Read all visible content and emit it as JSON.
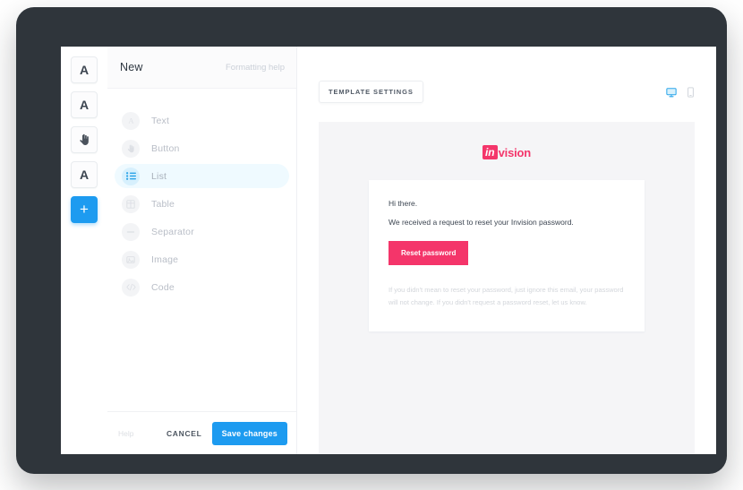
{
  "toolbar": {
    "buttons": [
      {
        "name": "text-style-heading",
        "glyph": "A",
        "accent": false
      },
      {
        "name": "text-style-body",
        "glyph": "A",
        "accent": false
      },
      {
        "name": "pointer-tool",
        "glyph": "hand",
        "accent": false
      },
      {
        "name": "text-style-small",
        "glyph": "A",
        "accent": false
      },
      {
        "name": "add-block",
        "glyph": "+",
        "accent": true
      }
    ]
  },
  "editor": {
    "title": "New",
    "formatting_help": "Formatting help",
    "blocks": [
      {
        "label": "Text",
        "icon": "text-icon",
        "selected": false
      },
      {
        "label": "Button",
        "icon": "button-icon",
        "selected": false
      },
      {
        "label": "List",
        "icon": "list-icon",
        "selected": true
      },
      {
        "label": "Table",
        "icon": "table-icon",
        "selected": false
      },
      {
        "label": "Separator",
        "icon": "separator-icon",
        "selected": false
      },
      {
        "label": "Image",
        "icon": "image-icon",
        "selected": false
      },
      {
        "label": "Code",
        "icon": "code-icon",
        "selected": false
      }
    ],
    "footer": {
      "help": "Help",
      "cancel_label": "CANCEL",
      "save_label": "Save changes"
    }
  },
  "preview": {
    "template_settings_label": "TEMPLATE SETTINGS",
    "viewports": [
      {
        "name": "desktop-view",
        "icon": "monitor-icon",
        "active": true
      },
      {
        "name": "mobile-view",
        "icon": "phone-icon",
        "active": false
      }
    ],
    "email": {
      "brand_mark": "in",
      "brand_word": "vision",
      "greeting": "Hi there.",
      "body": "We received a request to reset your Invision password.",
      "cta_label": "Reset password",
      "disclaimer": "If you didn't mean to reset your password, just ignore this email, your password will not change. If you didn't request a password reset, let us know."
    }
  },
  "colors": {
    "accent_blue": "#1d9bf0",
    "brand_pink": "#f4366b",
    "frame_dark": "#2f353b",
    "canvas_gray": "#f5f5f7"
  }
}
